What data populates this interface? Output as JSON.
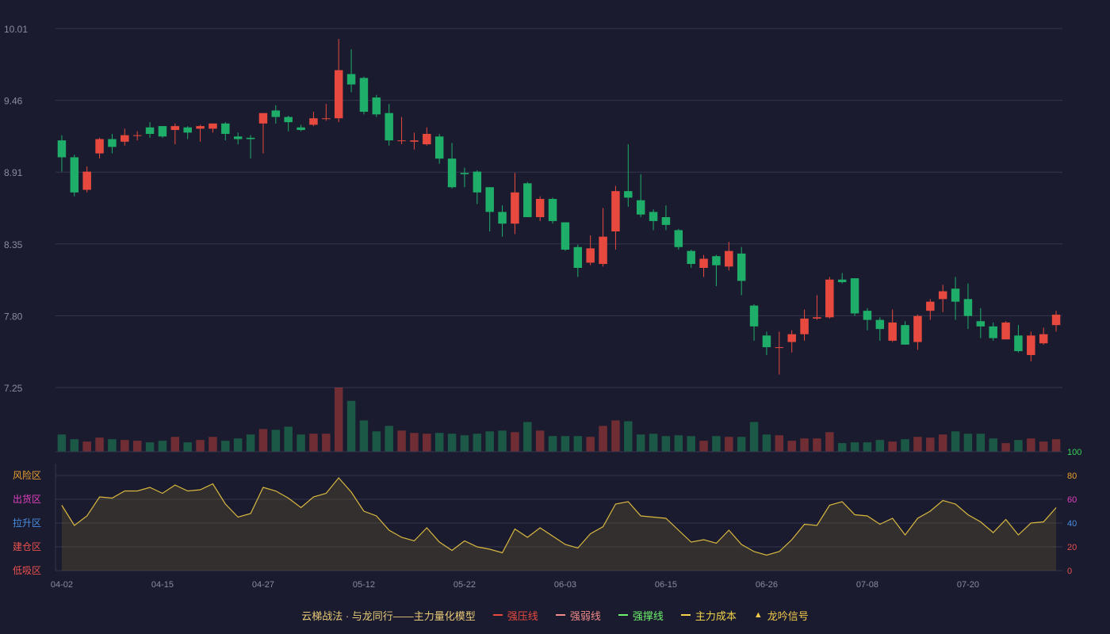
{
  "colors": {
    "background": "#1a1b2e",
    "up": "#e8493f",
    "down": "#1fae6a",
    "grid": "#34364f",
    "axis_text": "#8a8ca3",
    "osc_line": "#d9b840",
    "osc_fill": "rgba(120,100,50,0.28)"
  },
  "chart_data": [
    {
      "type": "candlestick",
      "y_ticks": [
        "10.01",
        "9.46",
        "8.91",
        "8.35",
        "7.80",
        "7.25"
      ],
      "ylim": [
        7.25,
        10.01
      ],
      "x_labels": [
        "04-02",
        "04-15",
        "04-27",
        "05-12",
        "05-22",
        "06-03",
        "06-15",
        "06-26",
        "07-08",
        "07-20"
      ],
      "label_every": 8,
      "candles": [
        [
          9.15,
          9.02,
          9.19,
          8.91
        ],
        [
          9.02,
          8.75,
          9.04,
          8.72
        ],
        [
          8.77,
          8.91,
          8.95,
          8.75
        ],
        [
          9.05,
          9.16,
          9.17,
          9.01
        ],
        [
          9.16,
          9.1,
          9.2,
          9.05
        ],
        [
          9.14,
          9.19,
          9.24,
          9.11
        ],
        [
          9.19,
          9.19,
          9.22,
          9.15
        ],
        [
          9.25,
          9.2,
          9.29,
          9.17
        ],
        [
          9.26,
          9.18,
          9.26,
          9.17
        ],
        [
          9.23,
          9.26,
          9.28,
          9.12
        ],
        [
          9.25,
          9.21,
          9.26,
          9.16
        ],
        [
          9.24,
          9.26,
          9.27,
          9.14
        ],
        [
          9.24,
          9.28,
          9.28,
          9.21
        ],
        [
          9.28,
          9.2,
          9.29,
          9.15
        ],
        [
          9.18,
          9.16,
          9.21,
          9.12
        ],
        [
          9.17,
          9.16,
          9.19,
          9.01
        ],
        [
          9.28,
          9.36,
          9.36,
          9.05
        ],
        [
          9.38,
          9.33,
          9.42,
          9.28
        ],
        [
          9.33,
          9.29,
          9.34,
          9.22
        ],
        [
          9.25,
          9.23,
          9.27,
          9.22
        ],
        [
          9.27,
          9.32,
          9.37,
          9.26
        ],
        [
          9.32,
          9.32,
          9.43,
          9.3
        ],
        [
          9.32,
          9.69,
          9.93,
          9.29
        ],
        [
          9.66,
          9.58,
          9.85,
          9.52
        ],
        [
          9.63,
          9.37,
          9.64,
          9.35
        ],
        [
          9.48,
          9.35,
          9.5,
          9.33
        ],
        [
          9.36,
          9.15,
          9.43,
          9.11
        ],
        [
          9.15,
          9.15,
          9.33,
          9.12
        ],
        [
          9.14,
          9.15,
          9.21,
          9.08
        ],
        [
          9.12,
          9.2,
          9.25,
          9.11
        ],
        [
          9.18,
          9.01,
          9.2,
          8.97
        ],
        [
          9.01,
          8.79,
          9.13,
          8.78
        ],
        [
          8.9,
          8.89,
          8.94,
          8.79
        ],
        [
          8.91,
          8.75,
          8.92,
          8.66
        ],
        [
          8.79,
          8.6,
          8.79,
          8.45
        ],
        [
          8.6,
          8.51,
          8.65,
          8.41
        ],
        [
          8.51,
          8.75,
          8.9,
          8.43
        ],
        [
          8.82,
          8.56,
          8.83,
          8.56
        ],
        [
          8.56,
          8.7,
          8.72,
          8.53
        ],
        [
          8.7,
          8.53,
          8.71,
          8.51
        ],
        [
          8.52,
          8.31,
          8.52,
          8.3
        ],
        [
          8.33,
          8.17,
          8.35,
          8.1
        ],
        [
          8.21,
          8.32,
          8.42,
          8.19
        ],
        [
          8.2,
          8.41,
          8.63,
          8.18
        ],
        [
          8.45,
          8.76,
          8.8,
          8.31
        ],
        [
          8.76,
          8.71,
          9.12,
          8.64
        ],
        [
          8.69,
          8.58,
          8.89,
          8.56
        ],
        [
          8.6,
          8.53,
          8.62,
          8.46
        ],
        [
          8.56,
          8.5,
          8.65,
          8.46
        ],
        [
          8.46,
          8.33,
          8.47,
          8.31
        ],
        [
          8.3,
          8.2,
          8.31,
          8.17
        ],
        [
          8.17,
          8.24,
          8.27,
          8.1
        ],
        [
          8.26,
          8.19,
          8.27,
          8.03
        ],
        [
          8.18,
          8.3,
          8.37,
          8.15
        ],
        [
          8.28,
          8.07,
          8.33,
          7.96
        ],
        [
          7.88,
          7.72,
          7.89,
          7.61
        ],
        [
          7.65,
          7.56,
          7.68,
          7.5
        ],
        [
          7.56,
          7.56,
          7.68,
          7.35
        ],
        [
          7.6,
          7.66,
          7.69,
          7.52
        ],
        [
          7.66,
          7.78,
          7.85,
          7.61
        ],
        [
          7.78,
          7.79,
          7.96,
          7.77
        ],
        [
          7.79,
          8.08,
          8.1,
          7.78
        ],
        [
          8.08,
          8.06,
          8.13,
          8.05
        ],
        [
          8.09,
          7.82,
          8.09,
          7.8
        ],
        [
          7.84,
          7.77,
          7.86,
          7.69
        ],
        [
          7.77,
          7.7,
          7.79,
          7.61
        ],
        [
          7.61,
          7.75,
          7.85,
          7.6
        ],
        [
          7.73,
          7.58,
          7.76,
          7.58
        ],
        [
          7.6,
          7.8,
          7.81,
          7.54
        ],
        [
          7.84,
          7.91,
          7.93,
          7.77
        ],
        [
          7.93,
          7.99,
          8.04,
          7.83
        ],
        [
          8.01,
          7.91,
          8.1,
          7.77
        ],
        [
          7.93,
          7.8,
          8.05,
          7.7
        ],
        [
          7.76,
          7.72,
          7.86,
          7.63
        ],
        [
          7.72,
          7.63,
          7.75,
          7.61
        ],
        [
          7.62,
          7.75,
          7.76,
          7.62
        ],
        [
          7.65,
          7.53,
          7.73,
          7.52
        ],
        [
          7.5,
          7.65,
          7.68,
          7.45
        ],
        [
          7.59,
          7.66,
          7.71,
          7.58
        ],
        [
          7.73,
          7.81,
          7.84,
          7.68
        ]
      ],
      "volumes": [
        22,
        16,
        13,
        18,
        16,
        15,
        14,
        12,
        14,
        19,
        12,
        15,
        19,
        14,
        17,
        22,
        29,
        28,
        32,
        22,
        23,
        23,
        82,
        65,
        40,
        26,
        33,
        27,
        24,
        23,
        24,
        23,
        21,
        23,
        26,
        27,
        25,
        38,
        27,
        20,
        20,
        20,
        19,
        33,
        40,
        39,
        22,
        23,
        20,
        21,
        20,
        14,
        20,
        19,
        19,
        38,
        22,
        21,
        14,
        17,
        17,
        25,
        11,
        12,
        12,
        15,
        13,
        16,
        19,
        18,
        22,
        26,
        23,
        23,
        17,
        11,
        15,
        17,
        13,
        16
      ],
      "volume_max": 82
    },
    {
      "type": "area",
      "y_ticks": [
        "100",
        "80",
        "60",
        "40",
        "20",
        "0"
      ],
      "y_tick_colors": [
        "#36d25a",
        "#e8a030",
        "#e040c0",
        "#4a8ee0",
        "#e85050",
        "#e85050"
      ],
      "ylim": [
        0,
        100
      ],
      "zones": [
        "风险区",
        "出货区",
        "拉升区",
        "建仓区",
        "低吸区"
      ],
      "zone_colors": [
        "#e8a030",
        "#e040c0",
        "#4a8ee0",
        "#e85050",
        "#e85050"
      ],
      "values": [
        55,
        38,
        46,
        62,
        61,
        67,
        67,
        70,
        65,
        72,
        67,
        68,
        73,
        56,
        45,
        48,
        70,
        67,
        61,
        53,
        62,
        65,
        78,
        66,
        50,
        46,
        34,
        28,
        25,
        36,
        24,
        17,
        25,
        20,
        18,
        15,
        35,
        28,
        36,
        29,
        22,
        19,
        31,
        37,
        56,
        58,
        46,
        45,
        44,
        34,
        24,
        26,
        23,
        34,
        22,
        16,
        13,
        16,
        26,
        39,
        38,
        55,
        58,
        47,
        46,
        39,
        44,
        30,
        44,
        50,
        59,
        56,
        47,
        41,
        32,
        43,
        30,
        40,
        41,
        53
      ]
    }
  ],
  "legend": {
    "title": "云梯战法 · 与龙同行——主力量化模型",
    "items": [
      {
        "label": "强压线",
        "color": "#e8493f",
        "style": "solid"
      },
      {
        "label": "强弱线",
        "color": "#f28a8a",
        "style": "dashed"
      },
      {
        "label": "强撑线",
        "color": "#6cf26c",
        "style": "solid"
      },
      {
        "label": "主力成本",
        "color": "#f2d34a",
        "style": "dashed"
      },
      {
        "label": "龙吟信号",
        "color": "#f2c94c",
        "style": "triangle"
      }
    ]
  }
}
